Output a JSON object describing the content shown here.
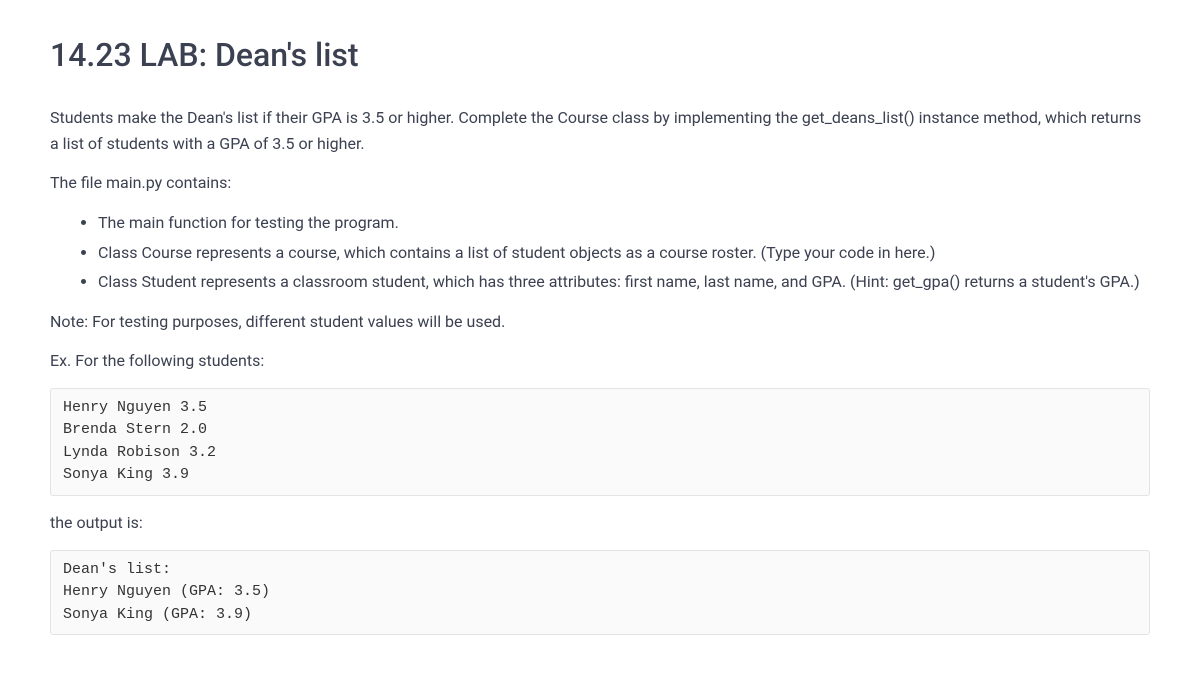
{
  "title": "14.23 LAB: Dean's list",
  "intro": "Students make the Dean's list if their GPA is 3.5 or higher. Complete the Course class by implementing the get_deans_list() instance method, which returns a list of students with a GPA of 3.5 or higher.",
  "file_line": "The file main.py contains:",
  "bullets": [
    "The main function for testing the program.",
    "Class Course represents a course, which contains a list of student objects as a course roster. (Type your code in here.)",
    "Class Student represents a classroom student, which has three attributes: first name, last name, and GPA. (Hint: get_gpa() returns a student's GPA.)"
  ],
  "note": "Note: For testing purposes, different student values will be used.",
  "ex_line": "Ex. For the following students:",
  "input_block": "Henry Nguyen 3.5\nBrenda Stern 2.0\nLynda Robison 3.2\nSonya King 3.9",
  "output_label": "the output is:",
  "output_block": "Dean's list:\nHenry Nguyen (GPA: 3.5)\nSonya King (GPA: 3.9)"
}
